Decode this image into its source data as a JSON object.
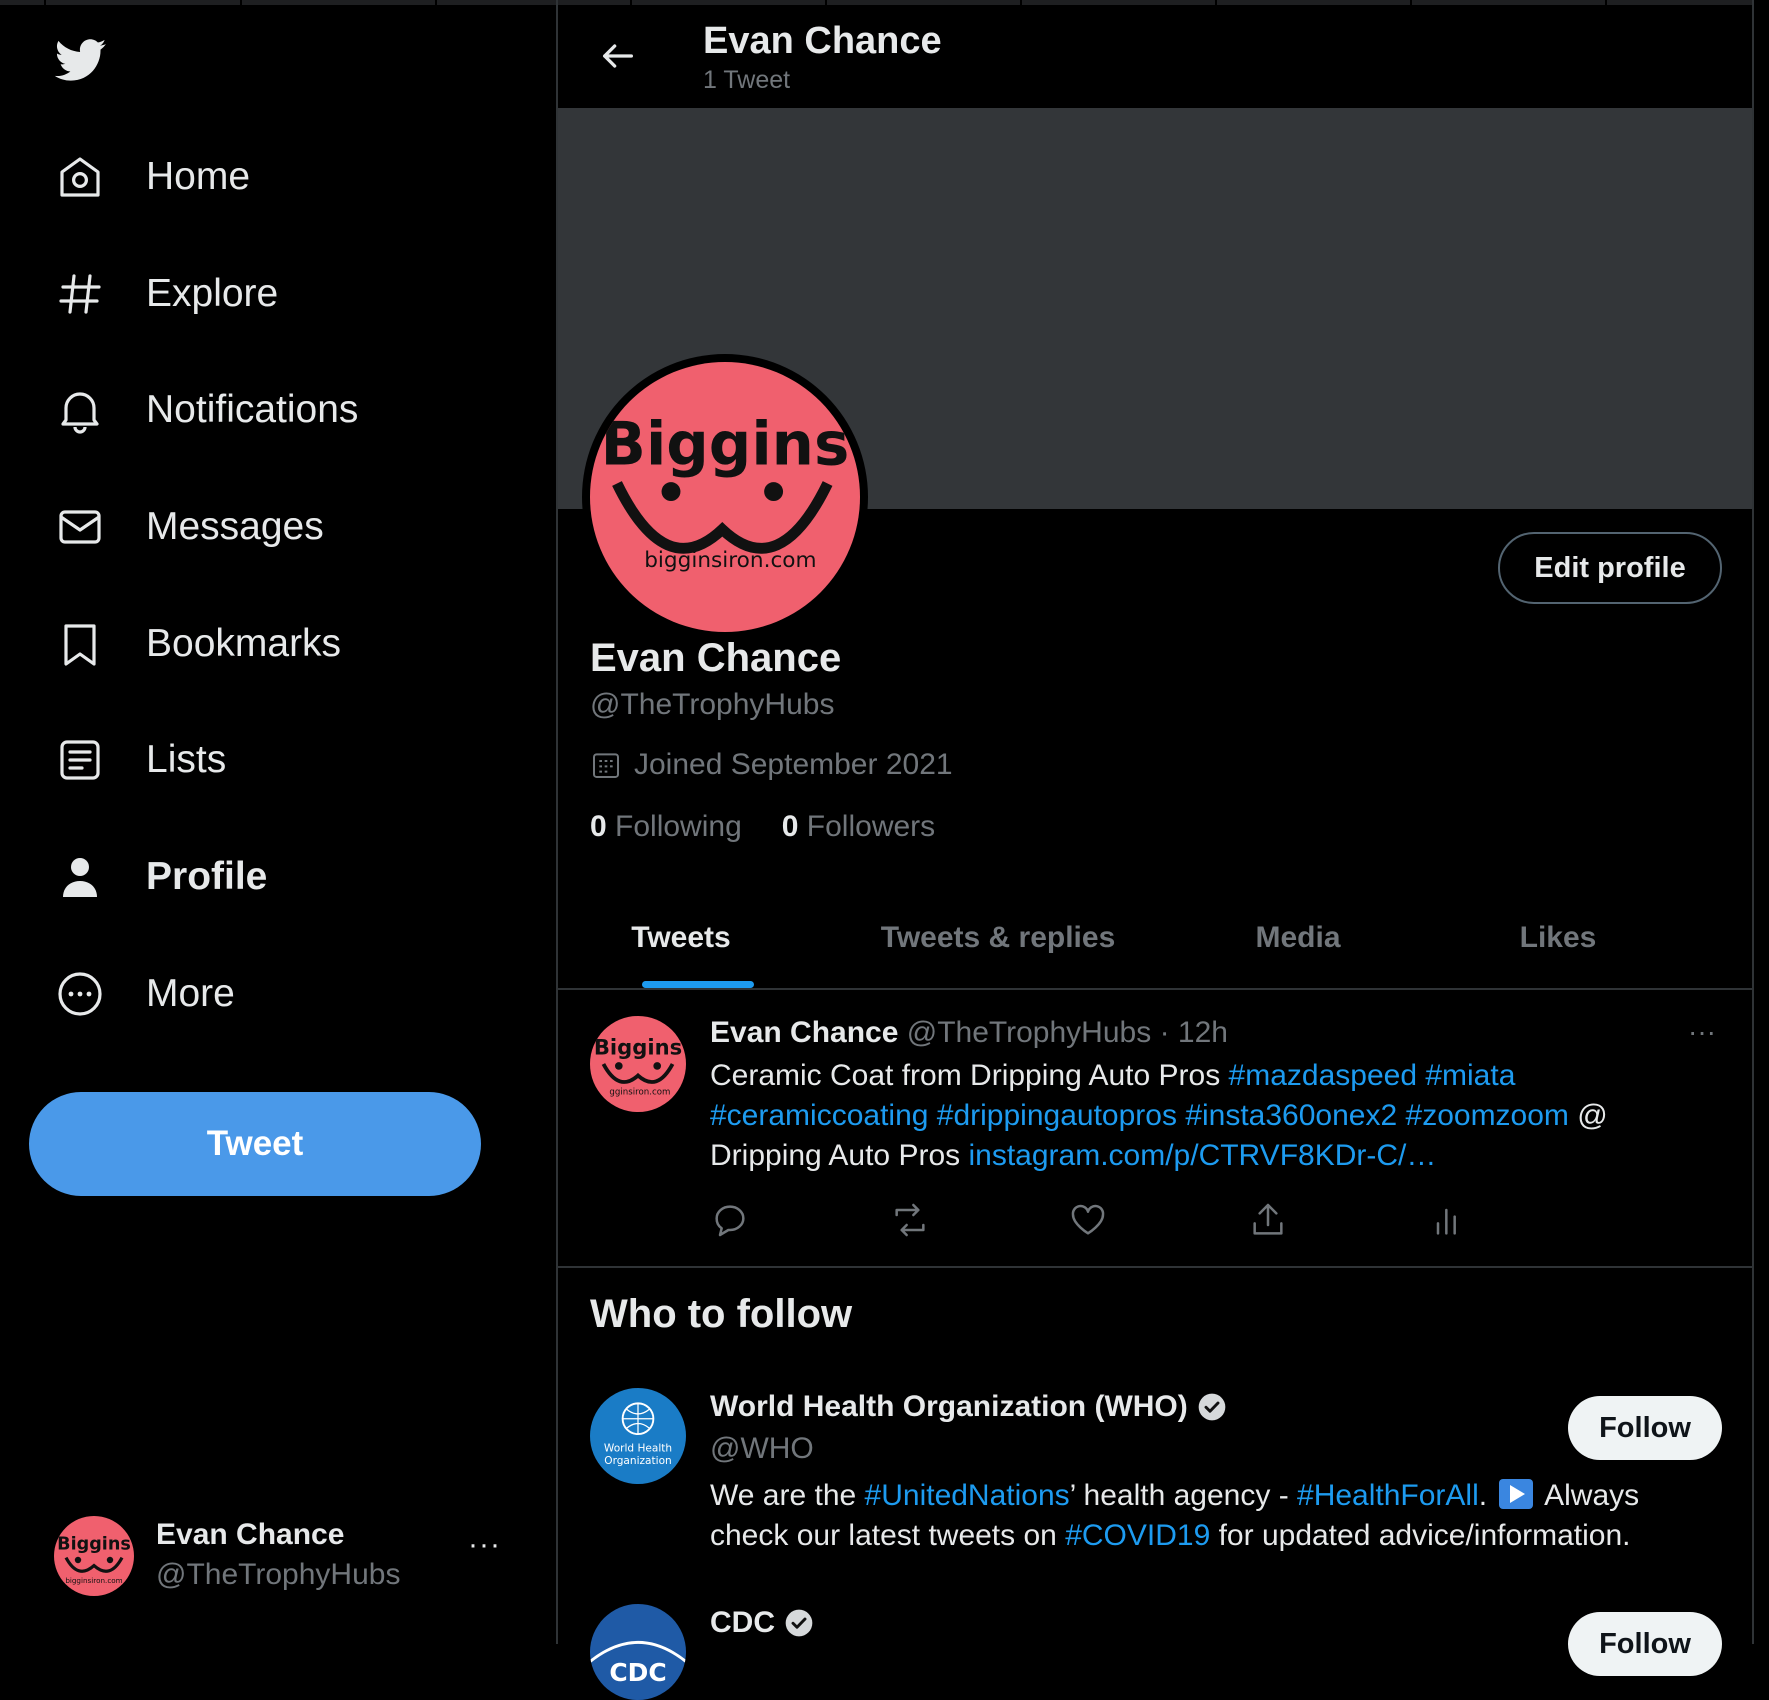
{
  "nav": {
    "items": [
      {
        "label": "Home",
        "icon": "home-icon"
      },
      {
        "label": "Explore",
        "icon": "hashtag-icon"
      },
      {
        "label": "Notifications",
        "icon": "bell-icon"
      },
      {
        "label": "Messages",
        "icon": "mail-icon"
      },
      {
        "label": "Bookmarks",
        "icon": "bookmark-icon"
      },
      {
        "label": "Lists",
        "icon": "list-icon"
      },
      {
        "label": "Profile",
        "icon": "person-icon"
      },
      {
        "label": "More",
        "icon": "more-circle-icon"
      }
    ],
    "active": "Profile",
    "tweet_button": "Tweet"
  },
  "account": {
    "name": "Evan Chance",
    "handle": "@TheTrophyHubs",
    "more": "···"
  },
  "header": {
    "name": "Evan Chance",
    "subtitle": "1 Tweet"
  },
  "profile": {
    "avatar_text": "Biggins",
    "avatar_sub": "bigginsiron.com",
    "edit_button": "Edit profile",
    "name": "Evan Chance",
    "handle": "@TheTrophyHubs",
    "joined": "Joined September 2021",
    "following_count": "0",
    "following_label": "Following",
    "followers_count": "0",
    "followers_label": "Followers"
  },
  "tabs": [
    "Tweets",
    "Tweets & replies",
    "Media",
    "Likes"
  ],
  "tweet": {
    "name": "Evan Chance",
    "handle": "@TheTrophyHubs",
    "time": "· 12h",
    "more": "···",
    "text_1": "Ceramic Coat from Dripping Auto Pros ",
    "tag_1": "#mazdaspeed",
    "tag_2": "#miata",
    "tag_3": "#ceramiccoating",
    "tag_4": "#drippingautopros",
    "tag_5": "#insta360onex2",
    "tag_6": "#zoomzoom",
    "text_2": " @ Dripping Auto Pros ",
    "link": "instagram.com/p/CTRVF8KDr-C/…"
  },
  "who_to_follow": {
    "title": "Who to follow",
    "accounts": [
      {
        "name": "World Health Organization (WHO)",
        "handle": "@WHO",
        "avatar_text_1": "World Health",
        "avatar_text_2": "Organization",
        "bio_1": "We are the ",
        "bio_tag_1": "#UnitedNations",
        "bio_2": "’ health agency - ",
        "bio_tag_2": "#HealthForAll",
        "bio_3": ". ",
        "bio_4": " Always check our latest tweets on ",
        "bio_tag_3": "#COVID19",
        "bio_5": " for updated advice/information.",
        "button": "Follow"
      },
      {
        "name": "CDC",
        "handle": "",
        "avatar_text": "CDC",
        "button": "Follow"
      }
    ]
  },
  "colors": {
    "accent": "#1d9bf0",
    "tweet_button": "#4a99e9",
    "banner": "#333639",
    "avatar_pink": "#f0606e"
  }
}
